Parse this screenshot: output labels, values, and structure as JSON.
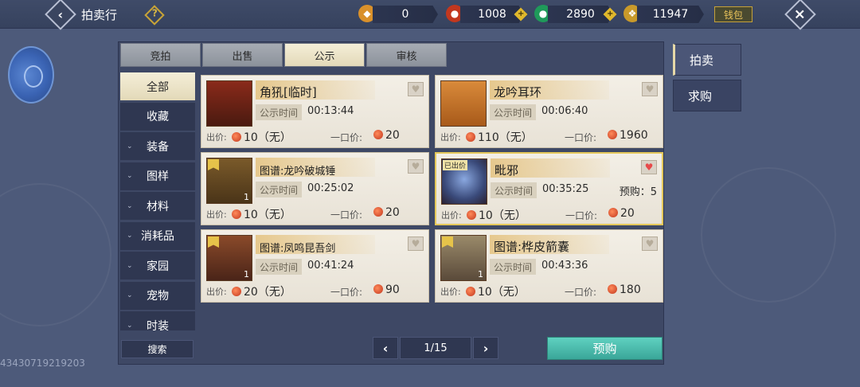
{
  "header": {
    "title": "拍卖行",
    "help_icon": "?",
    "wallet_label": "钱包",
    "currencies": [
      {
        "name": "gold-ingot",
        "value": "0"
      },
      {
        "name": "red-coin",
        "value": "1008"
      },
      {
        "name": "jade-coin",
        "value": "2890"
      },
      {
        "name": "gold-leaf",
        "value": "11947"
      }
    ]
  },
  "tabs": [
    "竞拍",
    "出售",
    "公示",
    "审核"
  ],
  "active_tab": "公示",
  "categories": [
    {
      "label": "全部",
      "expandable": false,
      "active": true
    },
    {
      "label": "收藏",
      "expandable": false
    },
    {
      "label": "装备",
      "expandable": true
    },
    {
      "label": "图样",
      "expandable": true
    },
    {
      "label": "材料",
      "expandable": true
    },
    {
      "label": "消耗品",
      "expandable": true
    },
    {
      "label": "家园",
      "expandable": false
    },
    {
      "label": "宠物",
      "expandable": true
    },
    {
      "label": "时装",
      "expandable": true
    }
  ],
  "search_label": "搜索",
  "labels": {
    "public_time": "公示时间",
    "bid_price": "出价:",
    "buyout_price": "一口价:",
    "no_bid": "（无）",
    "sold": "已出价",
    "preorder_prefix": "预购："
  },
  "items": [
    {
      "name": "角犼[临时]",
      "time": "00:13:44",
      "bid": "10",
      "bid_note": "（无）",
      "buyout": "20",
      "favorite": false,
      "qty": "",
      "sold": false
    },
    {
      "name": "龙吟耳环",
      "time": "00:06:40",
      "bid": "110",
      "bid_note": "（无）",
      "buyout": "1960",
      "favorite": false,
      "qty": "",
      "sold": false
    },
    {
      "name": "图谱:龙吟破城锤",
      "time": "00:25:02",
      "bid": "10",
      "bid_note": "（无）",
      "buyout": "20",
      "favorite": false,
      "qty": "1",
      "sold": false
    },
    {
      "name": "毗邪",
      "time": "00:35:25",
      "bid": "10",
      "bid_note": "（无）",
      "buyout": "20",
      "favorite": true,
      "qty": "",
      "sold": true,
      "preorder": "5"
    },
    {
      "name": "图谱:凤鸣昆吾剑",
      "time": "00:41:24",
      "bid": "20",
      "bid_note": "（无）",
      "buyout": "90",
      "favorite": false,
      "qty": "1",
      "sold": false
    },
    {
      "name": "图谱:桦皮箭囊",
      "time": "00:43:36",
      "bid": "10",
      "bid_note": "（无）",
      "buyout": "180",
      "favorite": false,
      "qty": "1",
      "sold": false
    }
  ],
  "pagination": {
    "text": "1/15"
  },
  "preorder_button": "预购",
  "side_tabs": [
    "拍卖",
    "求购"
  ],
  "uid": "43430719219203"
}
